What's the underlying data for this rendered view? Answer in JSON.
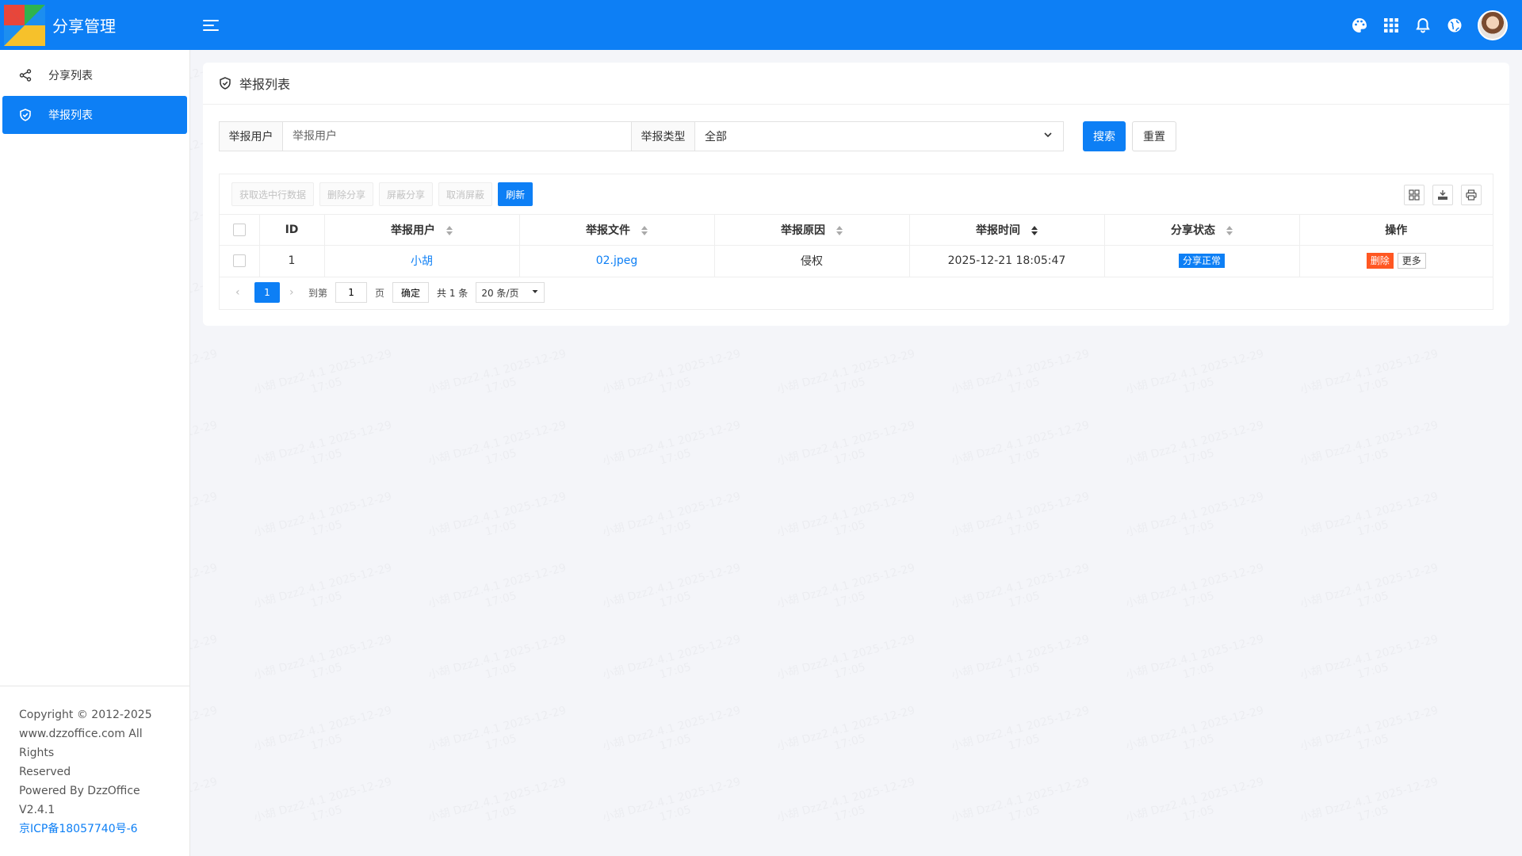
{
  "header": {
    "title": "分享管理",
    "icons": [
      "palette-icon",
      "apps-grid-icon",
      "bell-icon",
      "globe-icon"
    ]
  },
  "sidebar": {
    "items": [
      {
        "label": "分享列表",
        "icon": "share-icon",
        "active": false
      },
      {
        "label": "举报列表",
        "icon": "shield-icon",
        "active": true
      }
    ],
    "footer": {
      "copyright": "Copyright © 2012-2025",
      "site": "www.dzzoffice.com All Rights",
      "reserved": "Reserved",
      "powered": "Powered By DzzOffice V2.4.1",
      "icp": "京ICP备18057740号-6"
    }
  },
  "main": {
    "card_title": "举报列表",
    "search": {
      "user_label": "举报用户",
      "user_placeholder": "举报用户",
      "type_label": "举报类型",
      "type_value": "全部",
      "search_button": "搜索",
      "reset_button": "重置"
    },
    "toolbar": {
      "get_selected": "获取选中行数据",
      "delete_share": "删除分享",
      "block_share": "屏蔽分享",
      "unblock": "取消屏蔽",
      "refresh": "刷新"
    },
    "table": {
      "columns": [
        "ID",
        "举报用户",
        "举报文件",
        "举报原因",
        "举报时间",
        "分享状态",
        "操作"
      ],
      "rows": [
        {
          "id": "1",
          "user": "小胡",
          "file": "02.jpeg",
          "reason": "侵权",
          "time": "2025-12-21 18:05:47",
          "status": "分享正常",
          "delete": "删除",
          "more": "更多"
        }
      ]
    },
    "pager": {
      "current": "1",
      "goto_label": "到第",
      "page_input": "1",
      "page_unit": "页",
      "confirm": "确定",
      "total": "共 1 条",
      "page_size": "20 条/页"
    }
  },
  "watermark": {
    "line1": "小胡 Dzz2.4.1 2025-12-29",
    "line2": "17:05"
  },
  "colors": {
    "primary": "#0d7ff5",
    "danger": "#ff5722",
    "background": "#f4f5f9"
  }
}
